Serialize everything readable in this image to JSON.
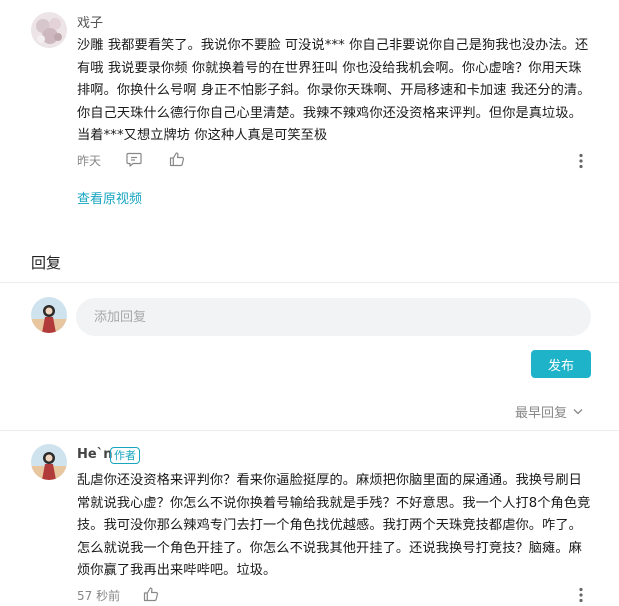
{
  "comment": {
    "author": "戏子",
    "text": "沙雕 我都要看笑了。我说你不要脸 可没说*** 你自己非要说你自己是狗我也没办法。还有哦 我说要录你频 你就换着号的在世界狂叫 你也没给我机会啊。你心虚啥？你用天珠排啊。你换什么号啊 身正不怕影子斜。你录你天珠啊、开局移速和卡加速 我还分的清。你自己天珠什么德行你自己心里清楚。我辣不辣鸡你还没资格来评判。但你是真垃圾。当着***又想立牌坊 你这种人真是可笑至极",
    "time": "昨天",
    "view_original": "查看原视频"
  },
  "reply_section": {
    "title": "回复",
    "input_placeholder": "添加回复",
    "publish_label": "发布",
    "sort_label": "最早回复"
  },
  "reply": {
    "author": "He`n",
    "author_badge": "作者",
    "text": "乱虐你还没资格来评判你？看来你逼脸挺厚的。麻烦把你脑里面的屎通通。我换号刷日常就说我心虚？你怎么不说你换着号输给我就是手残？不好意思。我一个人打8个角色竞技。我可没你那么辣鸡专门去打一个角色找优越感。我打两个天珠竞技都虐你。咋了。怎么就说我一个角色开挂了。你怎么不说我其他开挂了。还说我换号打竞技？脑瘫。麻烦你赢了我再出来哔哔吧。垃圾。",
    "time": "57 秒前"
  },
  "colors": {
    "accent": "#1fb3c9",
    "link": "#18a5c0",
    "meta": "#888888",
    "input_bg": "#f2f3f5"
  },
  "icons": [
    "comment-icon",
    "thumbs-up-icon",
    "more-vertical-icon",
    "chevron-down-icon"
  ]
}
